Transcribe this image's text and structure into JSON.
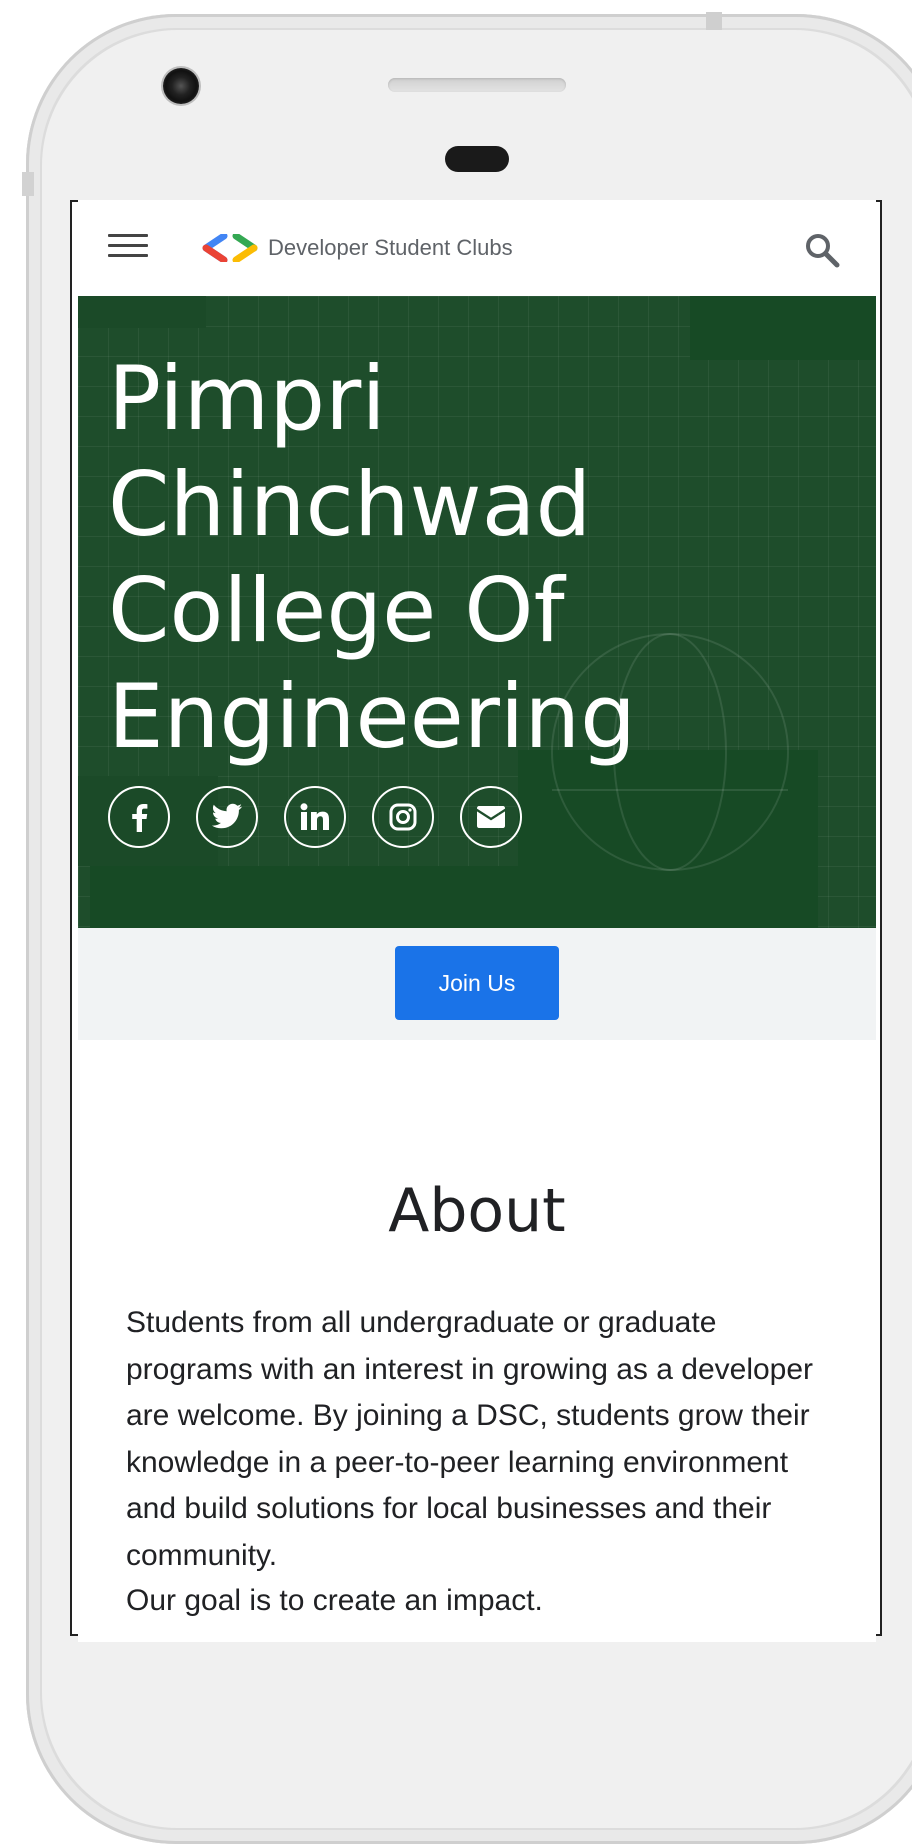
{
  "header": {
    "brand_text": "Developer Student Clubs",
    "menu_icon": "hamburger-menu-icon",
    "search_icon": "search-icon",
    "logo_colors": [
      "#ea4335",
      "#4285f4",
      "#34a853",
      "#fbbc04"
    ]
  },
  "hero": {
    "title_lines": [
      "Pimpri",
      "Chinchwad",
      "College Of",
      "Engineering"
    ],
    "background_color": "#1e4d2b",
    "socials": [
      {
        "icon": "facebook-icon"
      },
      {
        "icon": "twitter-icon"
      },
      {
        "icon": "linkedin-icon"
      },
      {
        "icon": "instagram-icon"
      },
      {
        "icon": "email-icon"
      }
    ]
  },
  "join": {
    "button_label": "Join Us",
    "button_color": "#1a73e8"
  },
  "about": {
    "title": "About",
    "body": "Students from all undergraduate or graduate programs with an interest in growing as a developer are welcome. By joining a DSC, students grow their knowledge in a peer-to-peer learning environment and build solutions for local businesses and their community.",
    "goal": "Our goal is to create an impact."
  }
}
